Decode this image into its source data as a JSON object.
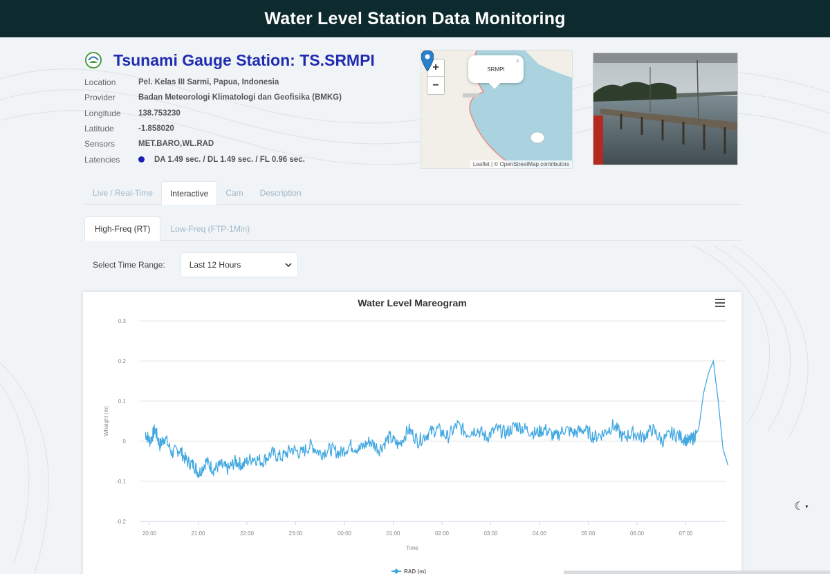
{
  "header": {
    "title": "Water Level Station Data Monitoring"
  },
  "station": {
    "title": "Tsunami Gauge Station: TS.SRMPI",
    "info": [
      {
        "key": "Location",
        "value": "Pel. Kelas III Sarmi, Papua, Indonesia"
      },
      {
        "key": "Provider",
        "value": "Badan Meteorologi Klimatologi dan Geofisika (BMKG)"
      },
      {
        "key": "Longitude",
        "value": "138.753230"
      },
      {
        "key": "Latitude",
        "value": "-1.858020"
      },
      {
        "key": "Sensors",
        "value": "MET.BARO,WL.RAD"
      },
      {
        "key": "Latencies",
        "value": "DA 1.49 sec. / DL 1.49 sec. / FL 0.96 sec.",
        "status_color": "#1a1fb8"
      }
    ]
  },
  "map": {
    "zoom_in": "+",
    "zoom_out": "−",
    "popup_label": "SRMPI",
    "popup_close": "×",
    "attribution": "Leaflet | © OpenStreetMap contributors",
    "marker_icon": "map-marker-icon"
  },
  "tabs": [
    "Live / Real-Time",
    "Interactive",
    "Cam",
    "Description"
  ],
  "active_tab": 1,
  "subtabs": [
    "High-Freq (RT)",
    "Low-Freq (FTP-1Min)"
  ],
  "active_subtab": 0,
  "time_range": {
    "label": "Select Time Range:",
    "selected": "Last 12 Hours"
  },
  "chart_data": {
    "type": "line",
    "title": "Water Level Mareogram",
    "xlabel": "Time",
    "ylabel": "Wheight (m)",
    "ylim": [
      -0.2,
      0.3
    ],
    "yticks": [
      "0.3",
      "0.2",
      "0.1",
      "0",
      "-0.1",
      "-0.2"
    ],
    "xticks": [
      "20:00",
      "21:00",
      "22:00",
      "23:00",
      "00:00",
      "01:00",
      "02:00",
      "03:00",
      "04:00",
      "05:00",
      "06:00",
      "07:00"
    ],
    "series": [
      {
        "name": "RAD (m)",
        "color": "#42a8e0",
        "x_hours": [
          0,
          0.1,
          0.2,
          0.3,
          0.4,
          0.55,
          0.7,
          0.85,
          1.0,
          1.1,
          1.25,
          1.4,
          1.55,
          1.7,
          1.85,
          2.0,
          2.2,
          2.4,
          2.6,
          2.8,
          3.0,
          3.2,
          3.4,
          3.6,
          3.8,
          4.0,
          4.2,
          4.4,
          4.6,
          4.8,
          5.0,
          5.2,
          5.4,
          5.6,
          5.8,
          6.0,
          6.2,
          6.4,
          6.6,
          6.8,
          7.0,
          7.2,
          7.4,
          7.6,
          7.8,
          8.0,
          8.2,
          8.4,
          8.6,
          8.8,
          9.0,
          9.2,
          9.4,
          9.6,
          9.8,
          10.0,
          10.2,
          10.4,
          10.6,
          10.8,
          11.0,
          11.15,
          11.25,
          11.35,
          11.45,
          11.55,
          11.65,
          11.75,
          11.85,
          11.95
        ],
        "values": [
          0.02,
          0.0,
          0.03,
          -0.01,
          0.01,
          -0.03,
          -0.02,
          -0.05,
          -0.06,
          -0.08,
          -0.05,
          -0.07,
          -0.06,
          -0.07,
          -0.05,
          -0.06,
          -0.04,
          -0.05,
          -0.03,
          -0.04,
          -0.02,
          -0.03,
          -0.01,
          -0.03,
          -0.02,
          -0.03,
          -0.01,
          -0.02,
          0.0,
          -0.02,
          0.01,
          -0.01,
          0.03,
          0.0,
          0.02,
          0.03,
          0.01,
          0.04,
          0.02,
          0.03,
          0.01,
          0.03,
          0.02,
          0.04,
          0.03,
          0.02,
          0.03,
          0.01,
          0.03,
          0.02,
          0.03,
          0.01,
          0.02,
          0.04,
          0.01,
          0.02,
          0.01,
          0.03,
          0.0,
          0.02,
          0.01,
          0.0,
          0.01,
          0.03,
          0.12,
          0.17,
          0.2,
          0.1,
          -0.02,
          -0.06
        ]
      }
    ],
    "legend_position": "bottom-center",
    "grid": true
  },
  "toolbar": {
    "menu_icon": "hamburger-menu-icon",
    "theme_icon": "moon-icon"
  }
}
